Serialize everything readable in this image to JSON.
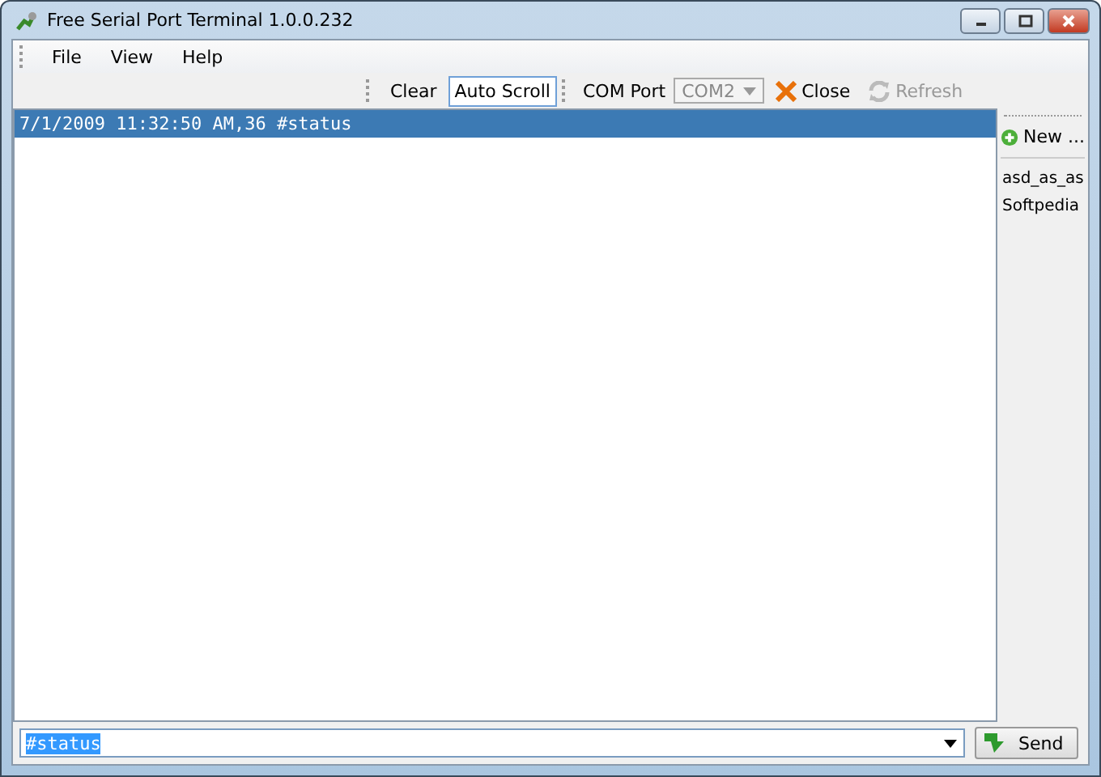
{
  "window": {
    "title": "Free Serial Port Terminal 1.0.0.232"
  },
  "menu": [
    {
      "label": "File"
    },
    {
      "label": "View"
    },
    {
      "label": "Help"
    }
  ],
  "toolbar": {
    "clear": "Clear",
    "auto_scroll": {
      "label": "Auto Scroll",
      "on": true
    },
    "port_label": "COM Port",
    "port": {
      "value": "COM2",
      "disabled": true
    },
    "close": "Close",
    "refresh": {
      "label": "Refresh",
      "disabled": true
    }
  },
  "log": [
    {
      "text": "7/1/2009 11:32:50 AM,36 #status",
      "selected": true
    }
  ],
  "sidebar": {
    "new": "New ...",
    "items": [
      {
        "label": "asd_as_as"
      },
      {
        "label": "Softpedia"
      }
    ]
  },
  "input": {
    "value": "#status",
    "selected": true
  },
  "send": "Send"
}
